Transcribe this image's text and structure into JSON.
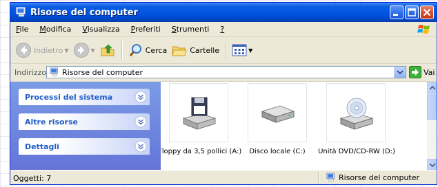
{
  "window": {
    "title": "Risorse del computer"
  },
  "menu": {
    "items": [
      {
        "accel": "F",
        "rest": "ile"
      },
      {
        "accel": "M",
        "rest": "odifica"
      },
      {
        "accel": "V",
        "rest": "isualizza"
      },
      {
        "accel": "P",
        "rest": "referiti"
      },
      {
        "accel": "S",
        "rest": "trumenti"
      },
      {
        "accel": "?",
        "rest": ""
      }
    ]
  },
  "toolbar": {
    "back_label": "Indietro",
    "search_label": "Cerca",
    "folders_label": "Cartelle"
  },
  "address": {
    "label": "Indirizzo",
    "value": "Risorse del computer",
    "go_label": "Vai"
  },
  "tasks": {
    "panels": [
      {
        "label": "Processi del sistema"
      },
      {
        "label": "Altre risorse"
      },
      {
        "label": "Dettagli"
      }
    ]
  },
  "files": {
    "items": [
      {
        "label": "Floppy da 3,5 pollici (A:)",
        "icon": "floppy-drive-icon"
      },
      {
        "label": "Disco locale (C:)",
        "icon": "hard-disk-icon"
      },
      {
        "label": "Unità DVD/CD-RW (D:)",
        "icon": "dvd-drive-icon"
      }
    ]
  },
  "status": {
    "left": "Oggetti: 7",
    "right": "Risorse del computer"
  },
  "colors": {
    "titlebar": "#0054e3",
    "taskpane": "#7b9ce6",
    "panel_text": "#215dc6",
    "window_bg": "#ece9d8"
  }
}
